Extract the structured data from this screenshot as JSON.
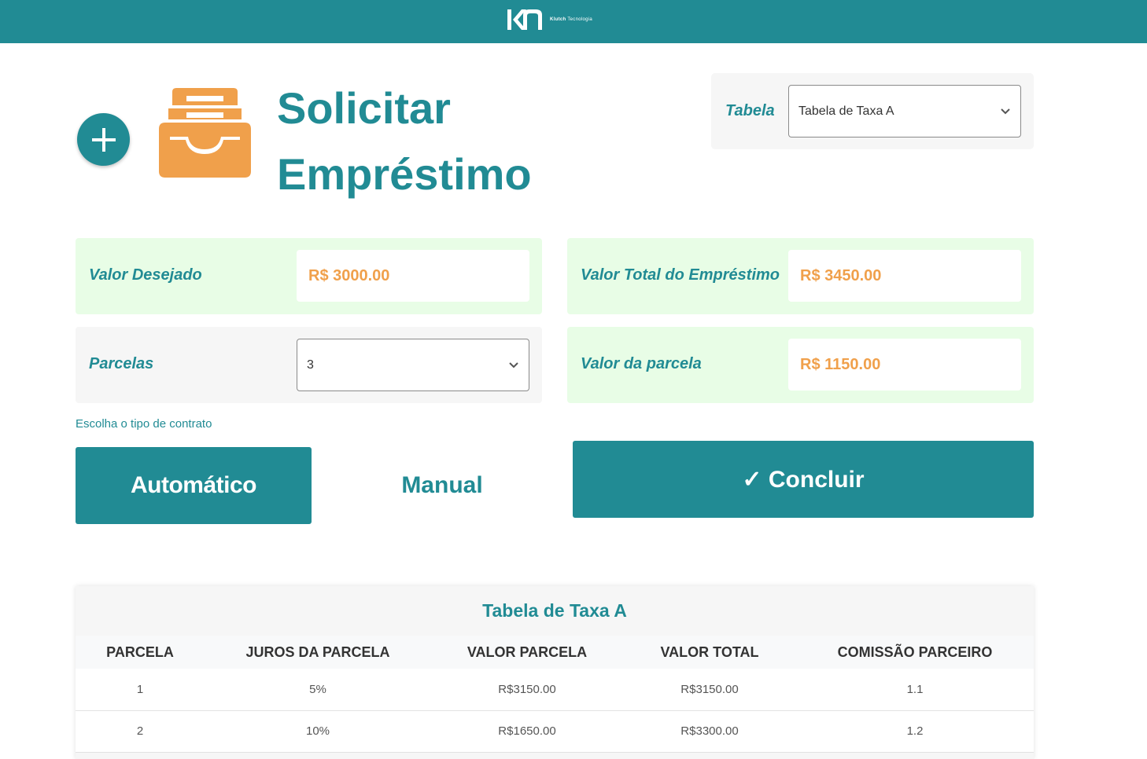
{
  "header": {
    "logo_mark": "KT",
    "brand_name": "Klutch",
    "brand_suffix": "Tecnologia",
    "bar_color": "#218b94"
  },
  "page": {
    "title_line1": "Solicitar",
    "title_line2": "Empréstimo",
    "add_icon": "plus-icon",
    "section_icon": "inbox-tray-icon",
    "accent_color": "#f0a04b"
  },
  "tabela": {
    "label": "Tabela",
    "selected": "Tabela de Taxa A"
  },
  "fields": {
    "valor_desejado": {
      "label": "Valor Desejado",
      "value": "R$ 3000.00"
    },
    "parcelas": {
      "label": "Parcelas",
      "selected": "3"
    },
    "valor_total": {
      "label": "Valor Total do Empréstimo",
      "value": "R$ 3450.00"
    },
    "valor_parcela": {
      "label": "Valor da parcela",
      "value": "R$ 1150.00"
    }
  },
  "contract": {
    "hint": "Escolha o tipo de contrato",
    "automatic_label": "Automático",
    "manual_label": "Manual",
    "conclude_label": "✓ Concluir"
  },
  "rate_table": {
    "title": "Tabela de Taxa A",
    "columns": [
      "PARCELA",
      "JUROS DA PARCELA",
      "VALOR PARCELA",
      "VALOR TOTAL",
      "COMISSÃO PARCEIRO"
    ],
    "rows": [
      [
        "1",
        "5%",
        "R$3150.00",
        "R$3150.00",
        "1.1"
      ],
      [
        "2",
        "10%",
        "R$1650.00",
        "R$3300.00",
        "1.2"
      ]
    ]
  }
}
